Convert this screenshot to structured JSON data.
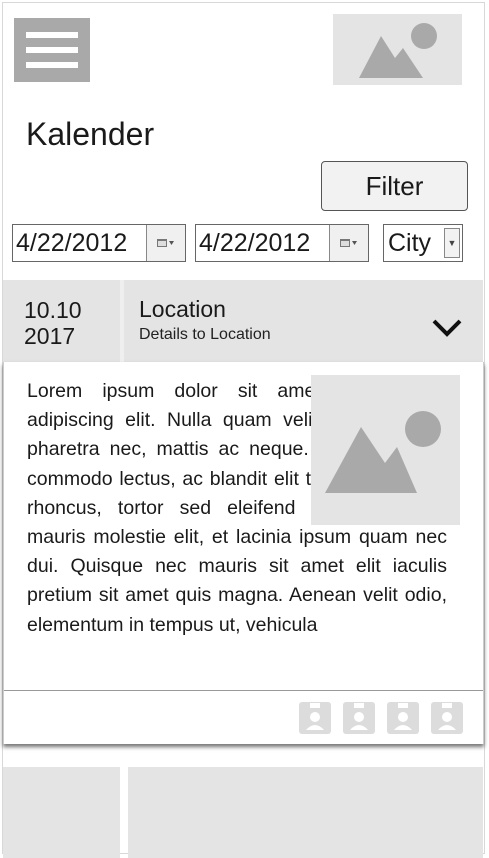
{
  "header": {
    "menu_icon": "hamburger-menu-icon",
    "profile_image_icon": "image-placeholder-icon"
  },
  "page": {
    "title": "Kalender"
  },
  "filter_bar": {
    "filter_label": "Filter",
    "date_from": "4/22/2012",
    "date_to": "4/22/2012",
    "calendar_icon": "calendar-icon",
    "city_select": "City",
    "caret_icon": "caret-down-icon"
  },
  "event": {
    "date_line1": "10.10",
    "date_line2": "2017",
    "location": "Location",
    "details": "Details to Location",
    "chevron_icon": "chevron-down-icon",
    "body": "Lorem ipsum dolor sit amet, consectetur adipiscing elit. Nulla quam velit, vulputate eu pharetra nec, mattis ac neque. Duis vulputate commodo lectus, ac blandit elit tincidunt id. Sed rhoncus, tortor sed eleifend tristique, tortor mauris molestie elit, et lacinia ipsum quam nec dui. Quisque nec mauris sit amet elit iaculis pretium sit amet quis magna. Aenean velit odio, elementum in tempus ut, vehicula",
    "image_icon": "image-placeholder-icon",
    "attendee_icon": "user-badge-icon",
    "attendee_count": 4
  },
  "colors": {
    "placeholder_bg": "#e4e4e4",
    "placeholder_fg": "#a9a9a9",
    "header_bg": "#e4e4e4"
  }
}
